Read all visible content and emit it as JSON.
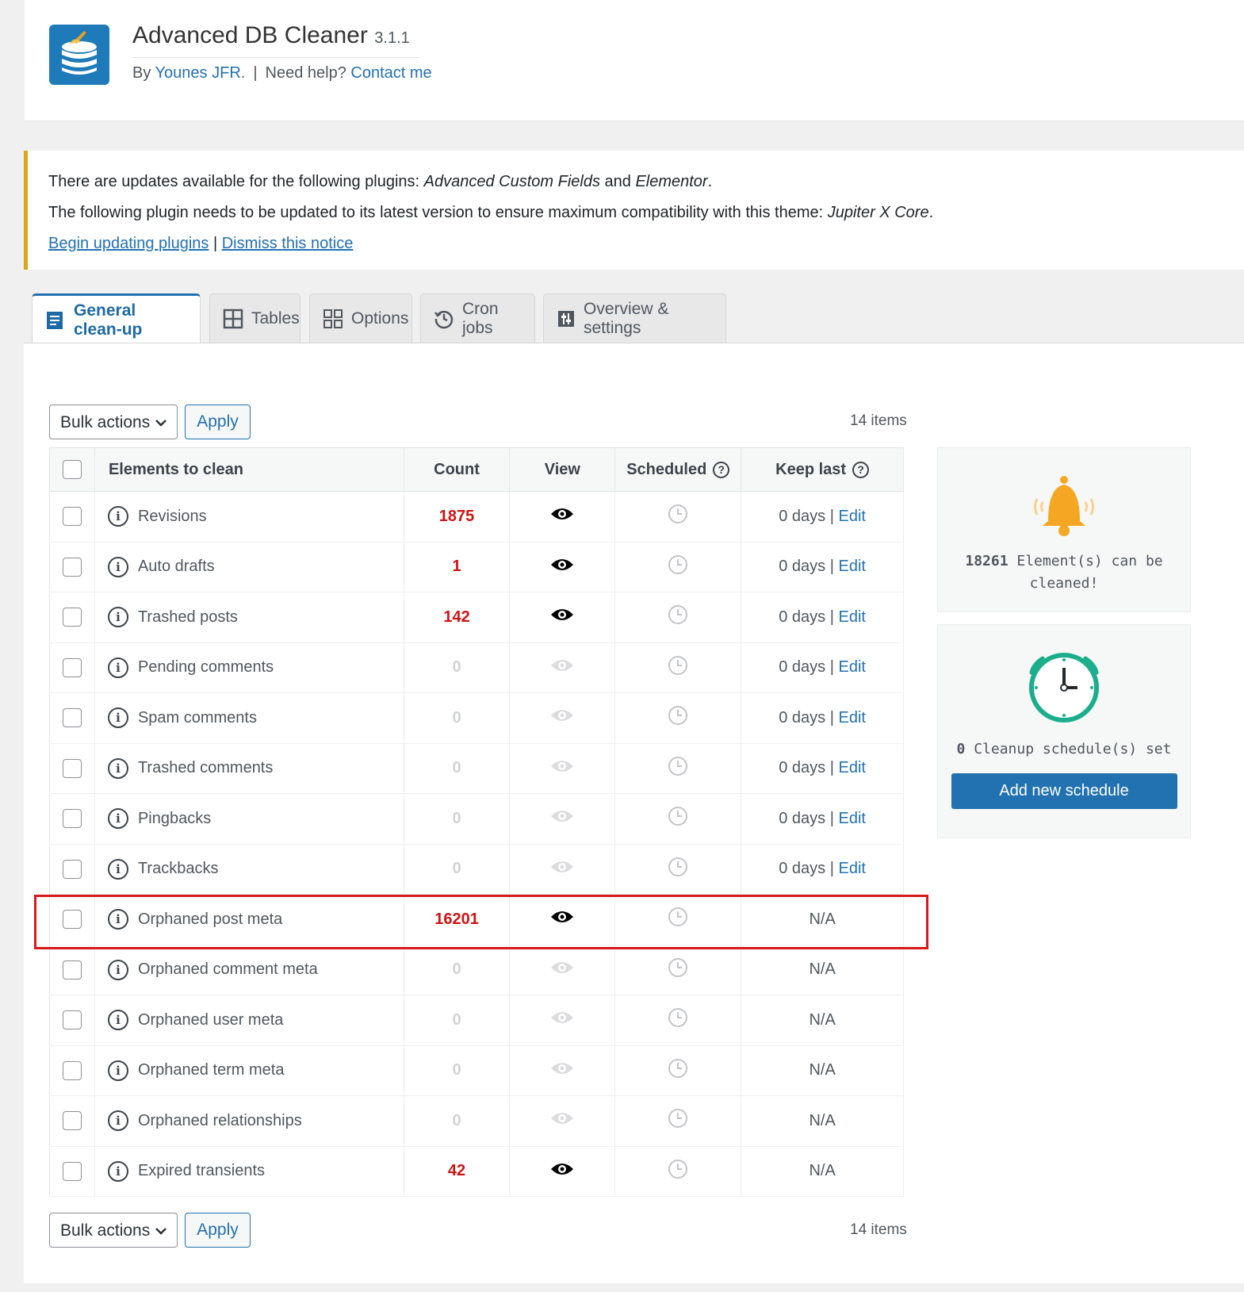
{
  "app": {
    "title": "Advanced DB Cleaner",
    "version": "3.1.1",
    "by": "By",
    "author": "Younes JFR.",
    "help_text": "Need help?",
    "contact": "Contact me"
  },
  "notice": {
    "line1_pre": "There are updates available for the following plugins: ",
    "line1_p1": "Advanced Custom Fields",
    "line1_and": " and ",
    "line1_p2": "Elementor",
    "line1_end": ".",
    "line2_pre": "The following plugin needs to be updated to its latest version to ensure maximum compatibility with this theme: ",
    "line2_p": "Jupiter X Core",
    "line2_end": ".",
    "link_begin": "Begin updating plugins",
    "link_sep": "|",
    "link_dismiss": "Dismiss this notice",
    "accent": "#dba617"
  },
  "tabs": [
    {
      "label": "General clean-up",
      "icon": "document-icon",
      "active": true
    },
    {
      "label": "Tables",
      "icon": "table-grid-icon"
    },
    {
      "label": "Options",
      "icon": "options-grid-icon"
    },
    {
      "label": "Cron jobs",
      "icon": "history-clock-icon"
    },
    {
      "label": "Overview & settings",
      "icon": "settings-sliders-icon"
    }
  ],
  "toolbar": {
    "bulk_label": "Bulk actions",
    "apply_label": "Apply",
    "items_count": "14 items"
  },
  "table": {
    "headers": {
      "name": "Elements to clean",
      "count": "Count",
      "view": "View",
      "scheduled": "Scheduled",
      "keep_last": "Keep last"
    },
    "rows": [
      {
        "name": "Revisions",
        "count": "1875",
        "keep_days": "0 days",
        "keep_sep": "|",
        "edit": "Edit"
      },
      {
        "name": "Auto drafts",
        "count": "1",
        "keep_days": "0 days",
        "keep_sep": "|",
        "edit": "Edit"
      },
      {
        "name": "Trashed posts",
        "count": "142",
        "keep_days": "0 days",
        "keep_sep": "|",
        "edit": "Edit"
      },
      {
        "name": "Pending comments",
        "count": "0",
        "keep_days": "0 days",
        "keep_sep": "|",
        "edit": "Edit"
      },
      {
        "name": "Spam comments",
        "count": "0",
        "keep_days": "0 days",
        "keep_sep": "|",
        "edit": "Edit"
      },
      {
        "name": "Trashed comments",
        "count": "0",
        "keep_days": "0 days",
        "keep_sep": "|",
        "edit": "Edit"
      },
      {
        "name": "Pingbacks",
        "count": "0",
        "keep_days": "0 days",
        "keep_sep": "|",
        "edit": "Edit"
      },
      {
        "name": "Trackbacks",
        "count": "0",
        "keep_days": "0 days",
        "keep_sep": "|",
        "edit": "Edit"
      },
      {
        "name": "Orphaned post meta",
        "count": "16201",
        "keep_na": "N/A"
      },
      {
        "name": "Orphaned comment meta",
        "count": "0",
        "keep_na": "N/A"
      },
      {
        "name": "Orphaned user meta",
        "count": "0",
        "keep_na": "N/A"
      },
      {
        "name": "Orphaned term meta",
        "count": "0",
        "keep_na": "N/A"
      },
      {
        "name": "Orphaned relationships",
        "count": "0",
        "keep_na": "N/A"
      },
      {
        "name": "Expired transients",
        "count": "42",
        "keep_na": "N/A"
      }
    ]
  },
  "summary": {
    "total": "18261",
    "total_text": " Element(s) can be cleaned!",
    "schedules": "0",
    "schedules_text": " Cleanup schedule(s) set",
    "add_schedule": "Add new schedule"
  },
  "colors": {
    "primary": "#2271b1",
    "count_red": "#d01313",
    "highlight": "#d71a1a",
    "bell": "#f5a623",
    "clock": "#1aae8c"
  }
}
